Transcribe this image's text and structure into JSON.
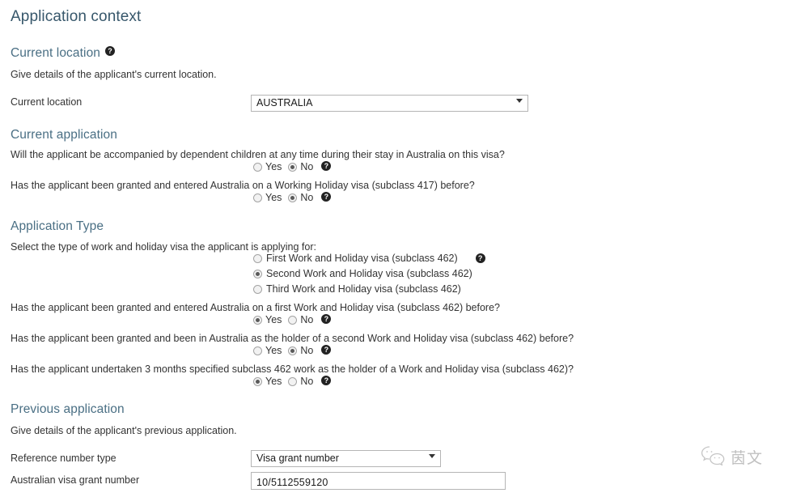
{
  "page": {
    "title": "Application context"
  },
  "sections": {
    "current_location": {
      "heading": "Current location",
      "help_icon": "help-circle-icon",
      "description": "Give details of the applicant's current location.",
      "field_label": "Current location",
      "field_value": "AUSTRALIA",
      "dropdown_icon": "chevron-down-icon"
    },
    "current_application": {
      "heading": "Current application",
      "questions": [
        {
          "text": "Will the applicant be accompanied by dependent children at any time during their stay in Australia on this visa?",
          "yes_label": "Yes",
          "no_label": "No",
          "selected": "No",
          "help_icon": "help-circle-icon"
        },
        {
          "text": "Has the applicant been granted and entered Australia on a Working Holiday visa (subclass 417) before?",
          "yes_label": "Yes",
          "no_label": "No",
          "selected": "No",
          "help_icon": "help-circle-icon"
        }
      ]
    },
    "application_type": {
      "heading": "Application Type",
      "prompt": "Select the type of work and holiday visa the applicant is applying for:",
      "options": [
        {
          "label": "First Work and Holiday visa (subclass 462)",
          "selected": false,
          "help_icon": "help-circle-icon"
        },
        {
          "label": "Second Work and Holiday visa (subclass 462)",
          "selected": true,
          "help_icon": ""
        },
        {
          "label": "Third Work and Holiday visa (subclass 462)",
          "selected": false,
          "help_icon": ""
        }
      ],
      "questions": [
        {
          "text": "Has the applicant been granted and entered Australia on a first Work and Holiday visa (subclass 462) before?",
          "yes_label": "Yes",
          "no_label": "No",
          "selected": "Yes",
          "help_icon": "help-circle-icon"
        },
        {
          "text": "Has the applicant been granted and been in Australia as the holder of a second Work and Holiday visa (subclass 462) before?",
          "yes_label": "Yes",
          "no_label": "No",
          "selected": "No",
          "help_icon": "help-circle-icon"
        },
        {
          "text": "Has the applicant undertaken 3 months specified subclass 462 work as the holder of a Work and Holiday visa (subclass 462)?",
          "yes_label": "Yes",
          "no_label": "No",
          "selected": "Yes",
          "help_icon": "help-circle-icon"
        }
      ]
    },
    "previous_application": {
      "heading": "Previous application",
      "description": "Give details of the applicant's previous application.",
      "reference_type_label": "Reference number type",
      "reference_type_value": "Visa grant number",
      "dropdown_icon": "chevron-down-icon",
      "grant_number_label": "Australian visa grant number",
      "grant_number_value": "10/5112559120"
    }
  },
  "watermark": {
    "icon": "wechat-logo-icon",
    "text": "茵文"
  },
  "help_glyph": "?"
}
